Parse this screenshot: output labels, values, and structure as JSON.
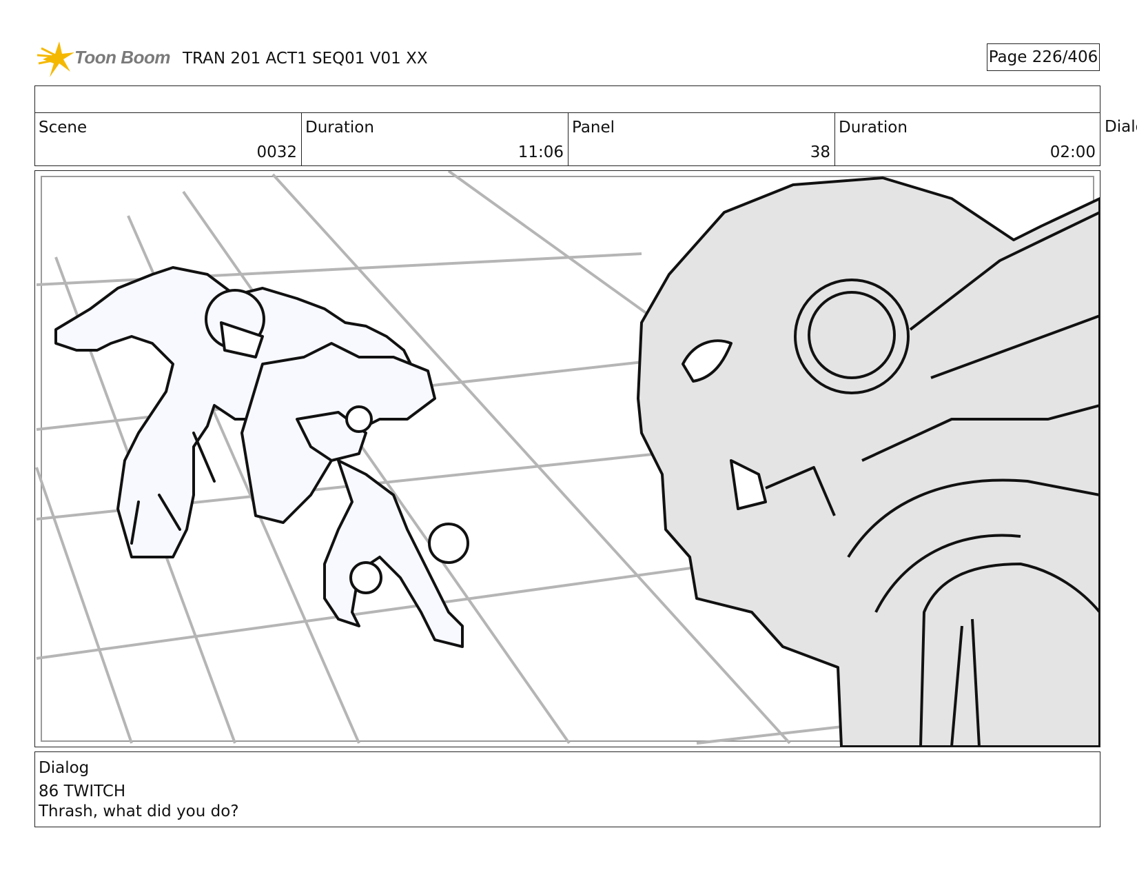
{
  "header": {
    "logo_text": "Toon Boom",
    "title": "TRAN 201 ACT1 SEQ01 V01 XX",
    "page": "Page 226/406"
  },
  "info": {
    "scene_label": "Scene",
    "scene_value": "0032",
    "scene_duration_label": "Duration",
    "scene_duration_value": "11:06",
    "panel_label": "Panel",
    "panel_value": "38",
    "panel_duration_label": "Duration",
    "panel_duration_value": "02:00",
    "overflow_label": "Dialo"
  },
  "panel": {
    "image": "storyboard-sketch"
  },
  "dialog": {
    "label": "Dialog",
    "character": "86 TWITCH",
    "line": "Thrash, what did you do?"
  },
  "colors": {
    "logo_star": "#f5b800",
    "grid_lines": "#b5b5b5",
    "sketch_ink": "#111111",
    "robot_fill": "#e4e4e4"
  }
}
